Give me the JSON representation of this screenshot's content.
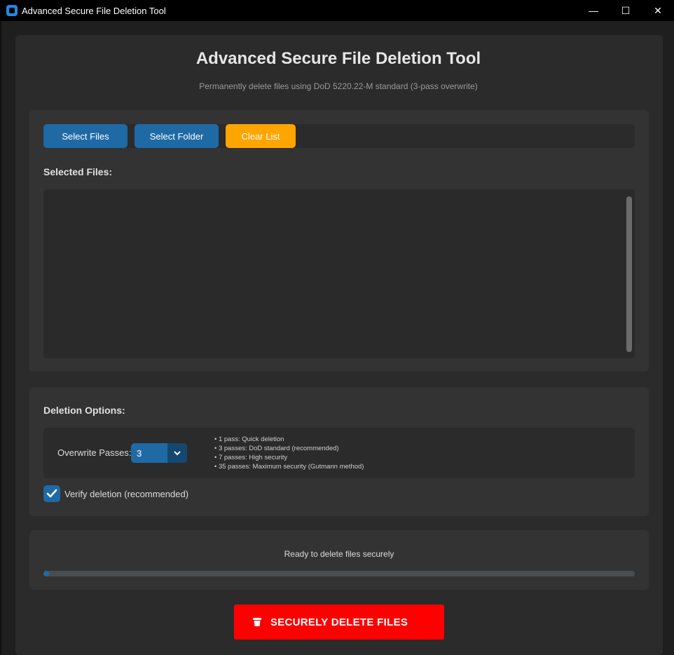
{
  "window": {
    "title": "Advanced Secure File Deletion Tool",
    "controls": {
      "minimize": "—",
      "maximize": "☐",
      "close": "✕"
    }
  },
  "header": {
    "title": "Advanced Secure File Deletion Tool",
    "subtitle": "Permanently delete files using DoD 5220.22-M standard (3-pass overwrite)"
  },
  "file_section": {
    "buttons": {
      "select_files": "Select Files",
      "select_folder": "Select Folder",
      "clear_list": "Clear List"
    },
    "label": "Selected Files:",
    "files": []
  },
  "options": {
    "label": "Deletion Options:",
    "passes_label": "Overwrite Passes:",
    "passes_value": "3",
    "passes_info": [
      "• 1 pass: Quick deletion",
      "• 3 passes: DoD standard (recommended)",
      "• 7 passes: High security",
      "• 35 passes: Maximum security (Gutmann method)"
    ],
    "verify_label": "Verify deletion (recommended)",
    "verify_checked": true
  },
  "progress": {
    "status": "Ready to delete files securely",
    "fraction": 0.01
  },
  "action": {
    "delete_label": "SECURELY DELETE FILES",
    "icon": "trash-icon"
  },
  "colors": {
    "accent_blue": "#1f6aa5",
    "clear_orange": "#ffa500",
    "danger_red": "#ff0000",
    "background": "#2b2b2b"
  }
}
